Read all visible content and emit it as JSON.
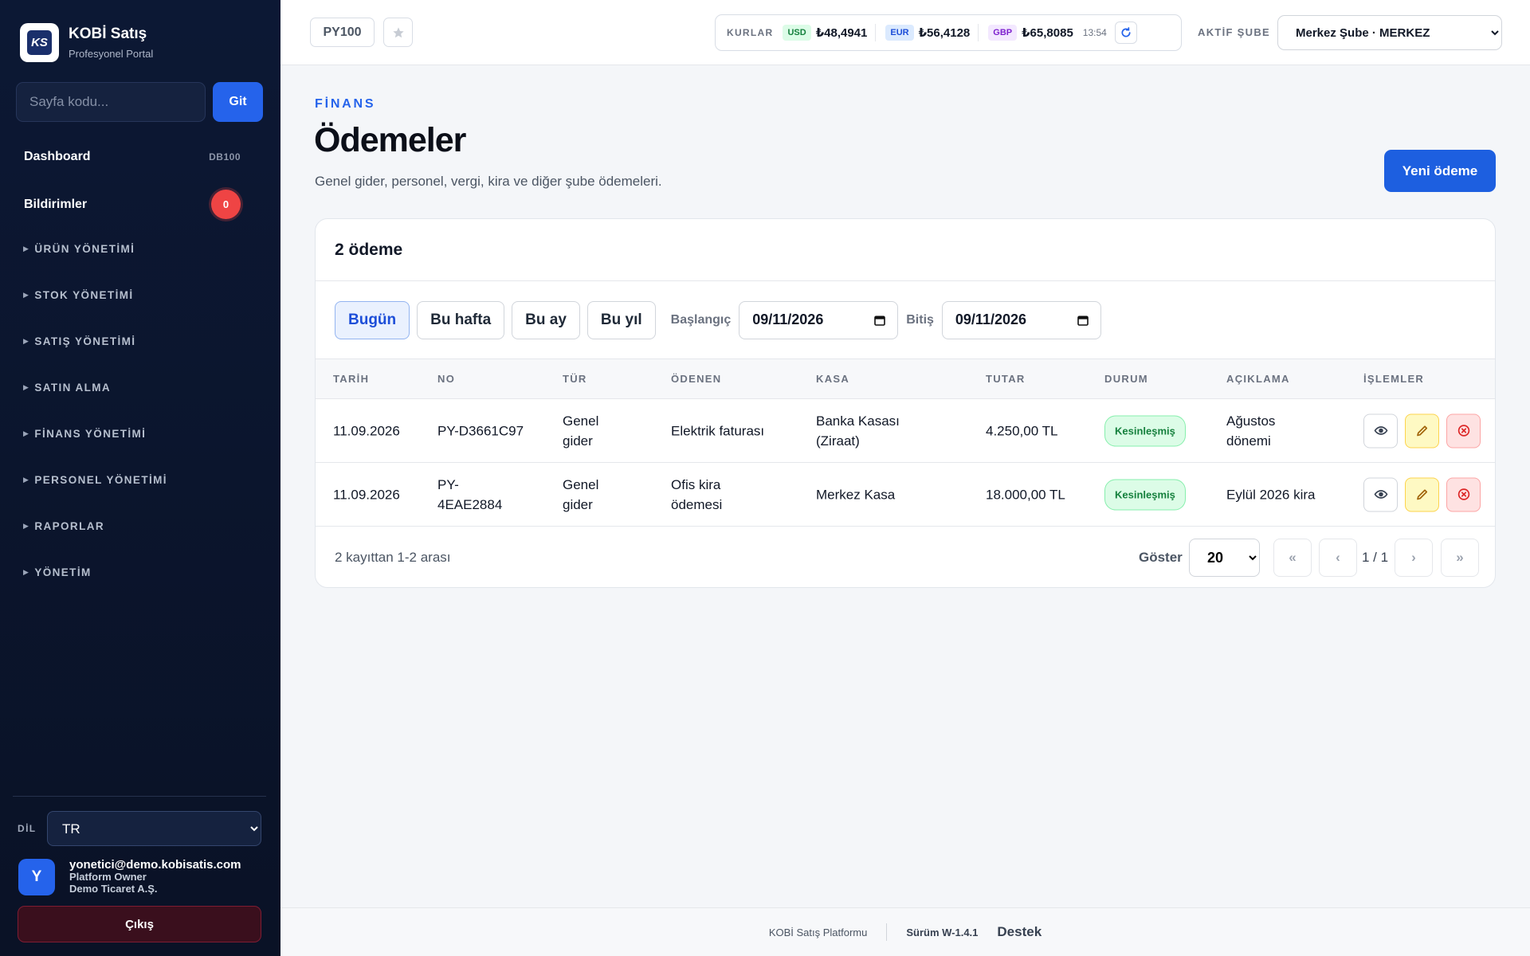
{
  "sidebar": {
    "brand_title": "KOBİ Satış",
    "brand_sub": "Profesyonel Portal",
    "brand_logo_text": "KS",
    "page_code_placeholder": "Sayfa kodu...",
    "go_label": "Git",
    "dashboard_label": "Dashboard",
    "dashboard_code": "DB100",
    "notifications_label": "Bildirimler",
    "notifications_count": "0",
    "groups": [
      "ÜRÜN YÖNETİMİ",
      "STOK YÖNETİMİ",
      "SATIŞ YÖNETİMİ",
      "SATIN ALMA",
      "FİNANS YÖNETİMİ",
      "PERSONEL YÖNETİMİ",
      "RAPORLAR",
      "YÖNETİM"
    ],
    "lang_label": "DİL",
    "lang_value": "TR",
    "user_initial": "Y",
    "user_email": "yonetici@demo.kobisatis.com",
    "user_role": "Platform Owner",
    "user_company": "Demo Ticaret A.Ş.",
    "logout_label": "Çıkış"
  },
  "topbar": {
    "page_code": "PY100",
    "rates_label": "KURLAR",
    "rates": [
      {
        "code": "USD",
        "value": "₺48,4941"
      },
      {
        "code": "EUR",
        "value": "₺56,4128"
      },
      {
        "code": "GBP",
        "value": "₺65,8085"
      }
    ],
    "rates_time": "13:54",
    "branch_label": "AKTİF ŞUBE",
    "branch_value": "Merkez Şube · MERKEZ"
  },
  "main": {
    "eyebrow": "FİNANS",
    "title": "Ödemeler",
    "description": "Genel gider, personel, vergi, kira ve diğer şube ödemeleri.",
    "new_button": "Yeni ödeme",
    "card_title": "2 ödeme",
    "filters": [
      "Bugün",
      "Bu hafta",
      "Bu ay",
      "Bu yıl"
    ],
    "start_label": "Başlangıç",
    "start_date": "09/11/2026",
    "end_label": "Bitiş",
    "end_date": "09/11/2026",
    "columns": [
      "TARİH",
      "NO",
      "TÜR",
      "ÖDENEN",
      "KASA",
      "TUTAR",
      "DURUM",
      "AÇIKLAMA",
      "İŞLEMLER"
    ],
    "rows": [
      {
        "date": "11.09.2026",
        "no": "PY-D3661C97",
        "type": "Genel gider",
        "paid": "Elektrik faturası",
        "cash": "Banka Kasası (Ziraat)",
        "amount": "4.250,00 TL",
        "status": "Kesinleşmiş",
        "desc": "Ağustos dönemi"
      },
      {
        "date": "11.09.2026",
        "no": "PY-4EAE2884",
        "type": "Genel gider",
        "paid": "Ofis kira ödemesi",
        "cash": "Merkez Kasa",
        "amount": "18.000,00 TL",
        "status": "Kesinleşmiş",
        "desc": "Eylül 2026 kira"
      }
    ],
    "foot_info": "2 kayıttan 1-2 arası",
    "show_label": "Göster",
    "page_size": "20",
    "pager": {
      "first": "«",
      "prev": "‹",
      "page": "1 / 1",
      "next": "›",
      "last": "»"
    }
  },
  "footer": {
    "platform": "KOBİ Satış Platformu",
    "version": "Sürüm W-1.4.1",
    "support": "Destek"
  },
  "colors": {
    "accent": "#2563eb",
    "sidebar_bg": "#0c1834",
    "success": "#15803d",
    "danger": "#ef4444"
  }
}
